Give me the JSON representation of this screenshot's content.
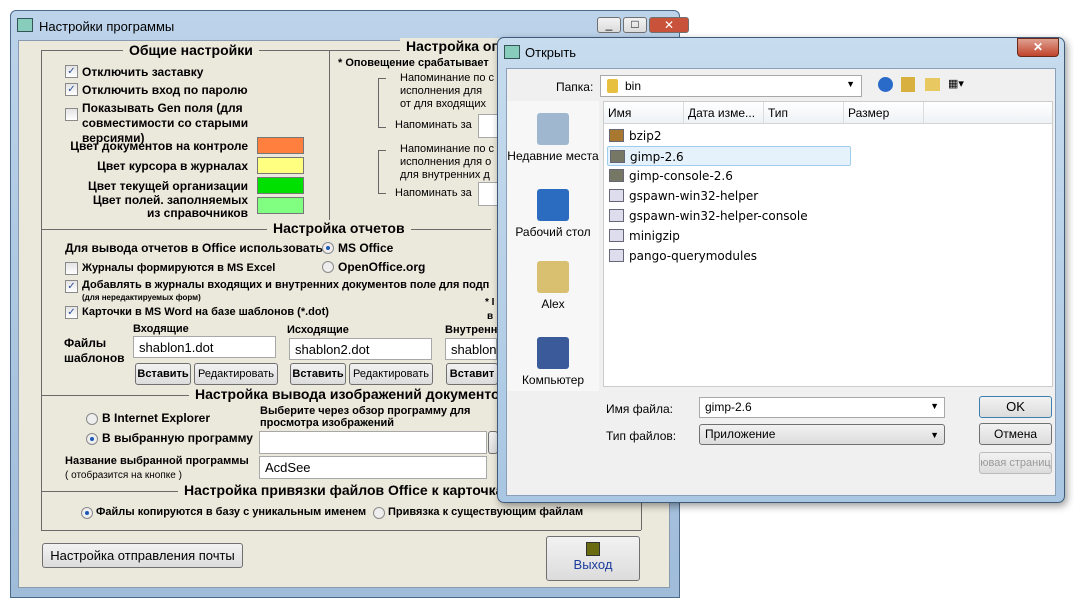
{
  "main_window": {
    "title": "Настройки программы",
    "general": {
      "title": "Общие настройки",
      "checkboxes": [
        {
          "label": "Отключить заставку",
          "checked": true
        },
        {
          "label": "Отключить вход по паролю",
          "checked": true
        },
        {
          "label": "Показывать Gen поля (для совместимости со старыми версиями)",
          "checked": false
        }
      ],
      "colors": [
        {
          "label": "Цвет документов на контроле",
          "color": "#ff7f3f"
        },
        {
          "label": "Цвет курсора в журналах",
          "color": "#ffff80"
        },
        {
          "label": "Цвет текущей организации",
          "color": "#00e000"
        },
        {
          "label": "Цвет полей. заполняемых из справочников",
          "color": "#80ff80"
        }
      ]
    },
    "notify": {
      "title": "Настройка оп",
      "note": "* Оповещение срабатывает",
      "incoming": "Напоминание по с исполнения для от для входящих",
      "internal": "Напоминание по с исполнения для о для внутренних д",
      "remind_label": "Напоминать за"
    },
    "reports": {
      "title": "Настройка отчетов",
      "office_label": "Для вывода отчетов в Office использовать",
      "office_options": [
        {
          "label": "MS Office",
          "selected": true
        },
        {
          "label": "OpenOffice.org",
          "selected": false
        }
      ],
      "excel": {
        "label": "Журналы формируются в MS Excel",
        "checked": false
      },
      "sign_field": {
        "label": "Добавлять в журналы входящих и внутренних документов поле для подп",
        "sub": "(для нередактируемых форм)",
        "checked": true
      },
      "word_cards": {
        "label": "Карточки в MS Word на базе шаблонов (*.dot)",
        "checked": true
      },
      "templates_label": "Файлы шаблонов",
      "side_note_1": "* I",
      "side_note_2": "в",
      "templates": [
        {
          "header": "Входящие",
          "value": "shablon1.dot"
        },
        {
          "header": "Исходящие",
          "value": "shablon2.dot"
        },
        {
          "header": "Внутренн",
          "value": "shablon"
        }
      ],
      "insert_label": "Вставить",
      "edit_label": "Редактировать",
      "insert_partial": "Вставит"
    },
    "images": {
      "title": "Настройка вывода изображений документов",
      "options": [
        {
          "label": "В Internet Explorer",
          "selected": false
        },
        {
          "label": "В выбранную программу",
          "selected": true
        }
      ],
      "choose_hint": "Выберите через обзор программу для просмотра изображений",
      "program_path": "",
      "name_label": "Название выбранной программы",
      "name_sub": "( отобразится на кнопке )",
      "program_name": "AcdSee"
    },
    "office_binding": {
      "title": "Настройка привязки файлов Office к карточкам",
      "options": [
        {
          "label": "Файлы копируются в базу с уникальным именем",
          "selected": true
        },
        {
          "label": "Привязка к существующим файлам",
          "selected": false
        }
      ]
    },
    "mail_button": "Настройка отправления почты",
    "exit_button": "Выход"
  },
  "open_dialog": {
    "title": "Открыть",
    "folder_label": "Папка:",
    "folder": "bin",
    "places": [
      "Недавние места",
      "Рабочий стол",
      "Alex",
      "Компьютер"
    ],
    "columns": [
      "Имя",
      "Дата изме...",
      "Тип",
      "Размер"
    ],
    "files": [
      "bzip2",
      "gimp-2.6",
      "gimp-console-2.6",
      "gspawn-win32-helper",
      "gspawn-win32-helper-console",
      "minigzip",
      "pango-querymodules"
    ],
    "selected_file": "gimp-2.6",
    "filename_label": "Имя файла:",
    "filename": "gimp-2.6",
    "filetype_label": "Тип файлов:",
    "filetype": "Приложение",
    "ok": "OK",
    "cancel": "Отмена",
    "third_button": "ювая страниц"
  }
}
